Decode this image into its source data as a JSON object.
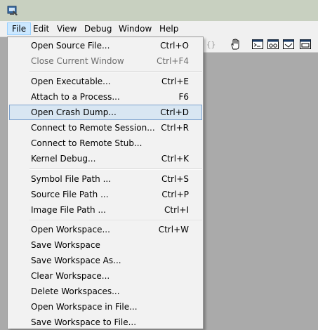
{
  "menubar": {
    "items": [
      {
        "label": "File"
      },
      {
        "label": "Edit"
      },
      {
        "label": "View"
      },
      {
        "label": "Debug"
      },
      {
        "label": "Window"
      },
      {
        "label": "Help"
      }
    ]
  },
  "file_menu": {
    "items": [
      {
        "label": "Open Source File...",
        "shortcut": "Ctrl+O"
      },
      {
        "label": "Close Current Window",
        "shortcut": "Ctrl+F4",
        "disabled": true
      },
      {
        "label": "Open Executable...",
        "shortcut": "Ctrl+E"
      },
      {
        "label": "Attach to a Process...",
        "shortcut": "F6"
      },
      {
        "label": "Open Crash Dump...",
        "shortcut": "Ctrl+D",
        "highlighted": true
      },
      {
        "label": "Connect to Remote Session...",
        "shortcut": "Ctrl+R"
      },
      {
        "label": "Connect to Remote Stub...",
        "shortcut": ""
      },
      {
        "label": "Kernel Debug...",
        "shortcut": "Ctrl+K"
      },
      {
        "label": "Symbol File Path ...",
        "shortcut": "Ctrl+S"
      },
      {
        "label": "Source File Path ...",
        "shortcut": "Ctrl+P"
      },
      {
        "label": "Image File Path ...",
        "shortcut": "Ctrl+I"
      },
      {
        "label": "Open Workspace...",
        "shortcut": "Ctrl+W"
      },
      {
        "label": "Save Workspace",
        "shortcut": ""
      },
      {
        "label": "Save Workspace As...",
        "shortcut": ""
      },
      {
        "label": "Clear Workspace...",
        "shortcut": ""
      },
      {
        "label": "Delete Workspaces...",
        "shortcut": ""
      },
      {
        "label": "Open Workspace in File...",
        "shortcut": ""
      },
      {
        "label": "Save Workspace to File...",
        "shortcut": ""
      }
    ]
  },
  "toolbar": {
    "icons": [
      "braces-icon",
      "hand-icon",
      "command-window-icon",
      "watch-window-icon",
      "locals-window-icon",
      "registers-window-icon"
    ]
  },
  "colors": {
    "menu_highlight": "#d8e6f2",
    "menu_highlight_border": "#7da2ce",
    "menubar_active": "#cce8ff",
    "workspace_bg": "#aaaaaa"
  }
}
